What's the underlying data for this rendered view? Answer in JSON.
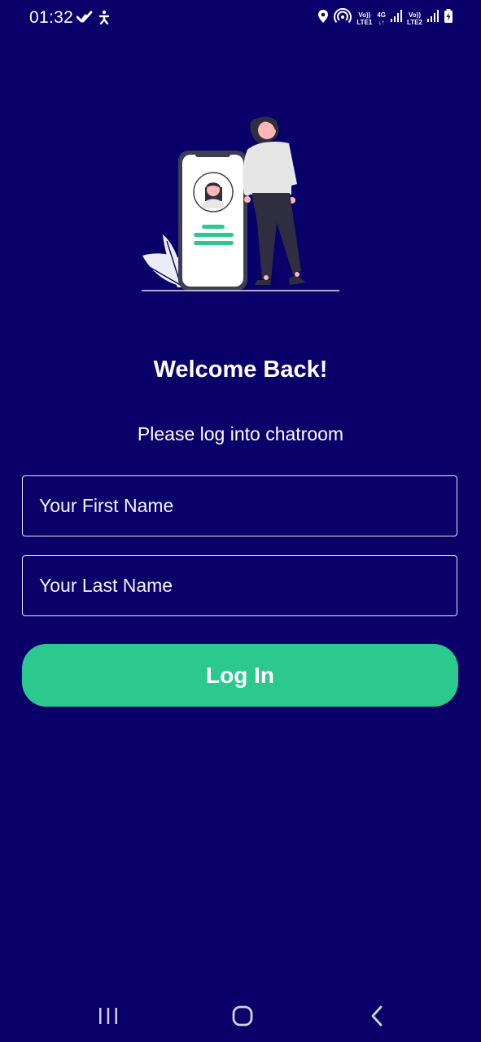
{
  "status_bar": {
    "time": "01:32",
    "left_icons": [
      "check-icon",
      "accessibility-icon"
    ],
    "right_icons": [
      "location-icon",
      "hotspot-icon",
      "volte-lte1-icon",
      "4g-icon",
      "signal-icon",
      "volte-lte2-icon",
      "signal-icon",
      "battery-charging-icon"
    ],
    "sim1_top": "Vo))",
    "sim1_bottom": "LTE1",
    "net_top": "4G",
    "net_bottom": "↓↑",
    "sim2_top": "Vo))",
    "sim2_bottom": "LTE2"
  },
  "login": {
    "title": "Welcome Back!",
    "subtitle": "Please log into chatroom",
    "first_name_placeholder": "Your First Name",
    "last_name_placeholder": "Your Last Name",
    "first_name_value": "",
    "last_name_value": "",
    "button_label": "Log In"
  },
  "nav": {
    "icons": [
      "recent-apps-icon",
      "home-icon",
      "back-icon"
    ]
  },
  "colors": {
    "background": "#0a006a",
    "accent": "#2bc98e",
    "text": "#ffffff"
  }
}
